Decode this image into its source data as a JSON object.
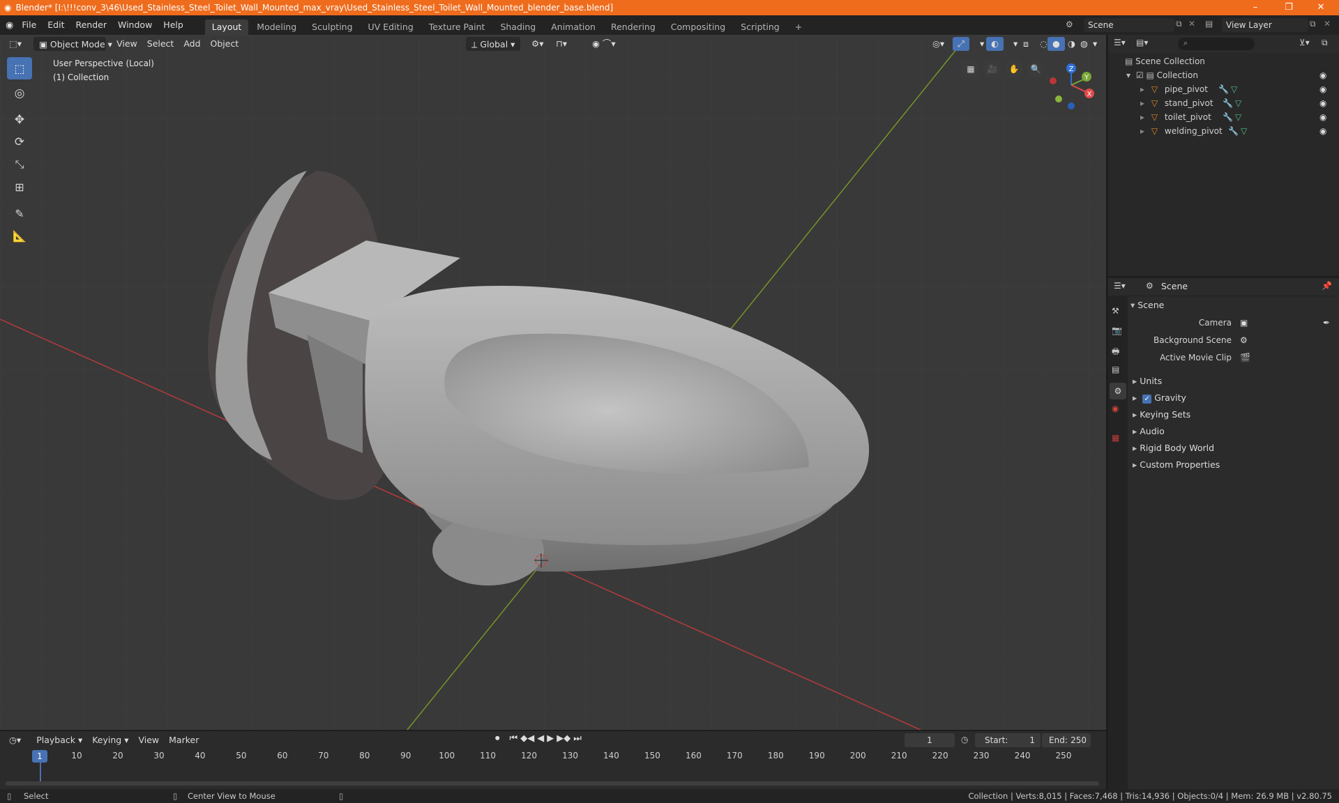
{
  "window": {
    "title": "Blender* [I:\\!!!conv_3\\46\\Used_Stainless_Steel_Toilet_Wall_Mounted_max_vray\\Used_Stainless_Steel_Toilet_Wall_Mounted_blender_base.blend]",
    "minimize": "–",
    "maximize": "❐",
    "close": "✕"
  },
  "menus": [
    "File",
    "Edit",
    "Render",
    "Window",
    "Help"
  ],
  "workspaces": [
    "Layout",
    "Modeling",
    "Sculpting",
    "UV Editing",
    "Texture Paint",
    "Shading",
    "Animation",
    "Rendering",
    "Compositing",
    "Scripting"
  ],
  "active_workspace": "Layout",
  "add_workspace": "+",
  "scene_field": "Scene",
  "view_layer_field": "View Layer",
  "viewport": {
    "mode": "Object Mode",
    "menus": [
      "View",
      "Select",
      "Add",
      "Object"
    ],
    "orientation": "Global",
    "overlay_line1": "User Perspective (Local)",
    "overlay_line2": "(1) Collection",
    "gizmo": {
      "x": "X",
      "y": "Y",
      "z": "Z"
    },
    "colors": {
      "bg": "#393939",
      "x_axis": "#bf3a3a",
      "y_axis": "#7a9a26",
      "active_tool": "#4772b3"
    }
  },
  "outliner": {
    "root": "Scene Collection",
    "collection": "Collection",
    "objects": [
      "pipe_pivot",
      "stand_pivot",
      "toilet_pivot",
      "welding_pivot"
    ]
  },
  "properties": {
    "context": "Scene",
    "panel_title": "Scene",
    "fields": [
      {
        "label": "Camera",
        "value": ""
      },
      {
        "label": "Background Scene",
        "value": ""
      },
      {
        "label": "Active Movie Clip",
        "value": ""
      }
    ],
    "sections": [
      "Units",
      "Gravity",
      "Keying Sets",
      "Audio",
      "Rigid Body World",
      "Custom Properties"
    ],
    "gravity_checked": true
  },
  "timeline": {
    "menus": [
      "Playback",
      "Keying",
      "View",
      "Marker"
    ],
    "current_frame": "1",
    "start_label": "Start:",
    "start": "1",
    "end_label": "End:",
    "end": "250",
    "ticks": [
      "1",
      "10",
      "20",
      "30",
      "40",
      "50",
      "60",
      "70",
      "80",
      "90",
      "100",
      "110",
      "120",
      "130",
      "140",
      "150",
      "160",
      "170",
      "180",
      "190",
      "200",
      "210",
      "220",
      "230",
      "240",
      "250"
    ]
  },
  "status": {
    "select": "Select",
    "center": "Center View to Mouse",
    "stats": "Collection | Verts:8,015 | Faces:7,468 | Tris:14,936 | Objects:0/4 | Mem: 26.9 MB | v2.80.75"
  }
}
